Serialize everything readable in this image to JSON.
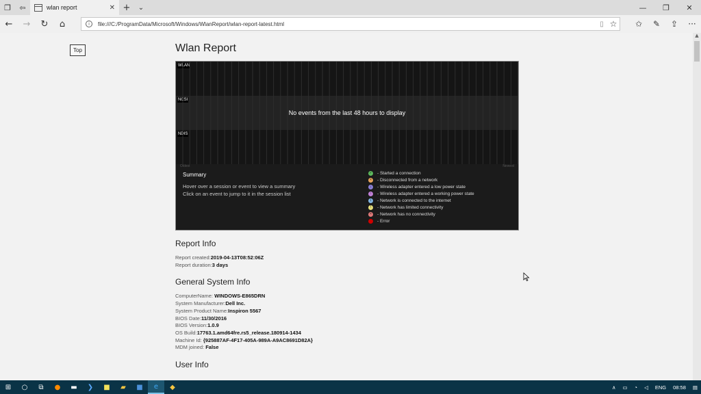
{
  "tab": {
    "title": "wlan report"
  },
  "address": {
    "url": "file:///C:/ProgramData/Microsoft/Windows/WlanReport/wlan-report-latest.html"
  },
  "page": {
    "top_button": "Top",
    "title": "Wlan Report",
    "graph": {
      "lanes": [
        "WLAN",
        "NCSI",
        "NDIS"
      ],
      "no_events": "No events from the last 48 hours to display",
      "axis_left": "Oldest",
      "axis_right": "Newest",
      "summary_title": "Summary",
      "summary_line1": "Hover over a session or event to view a summary",
      "summary_line2": "Click on an event to jump to it in the session list",
      "legend": [
        {
          "label": "- Started a connection",
          "color": "#5cb85c",
          "glyph": "✓"
        },
        {
          "label": "- Disconnected from a network",
          "color": "#e8a35a",
          "glyph": "×"
        },
        {
          "label": "- Wireless adapter entered a low power state",
          "color": "#8a7fd6",
          "glyph": "↓"
        },
        {
          "label": "- Wireless adapter entered a working power state",
          "color": "#c07fd6",
          "glyph": "↑"
        },
        {
          "label": "- Network is connected to the internet",
          "color": "#7fb3e0",
          "glyph": "i"
        },
        {
          "label": "- Network has limited connectivity",
          "color": "#e8e07a",
          "glyph": "!"
        },
        {
          "label": "- Network has no connectivity",
          "color": "#e07a7a",
          "glyph": "×"
        },
        {
          "label": "- Error",
          "color": "#d00000",
          "glyph": ""
        }
      ]
    },
    "report_info": {
      "heading": "Report Info",
      "created_label": "Report created:",
      "created_value": "2019-04-13T08:52:06Z",
      "duration_label": "Report duration:",
      "duration_value": "3 days"
    },
    "system_info": {
      "heading": "General System Info",
      "rows": [
        {
          "label": "ComputerName: ",
          "value": "WINDOWS-E865DRN"
        },
        {
          "label": "System Manufacturer:",
          "value": "Dell Inc."
        },
        {
          "label": "System Product Name:",
          "value": "Inspiron 5567"
        },
        {
          "label": "BIOS Date:",
          "value": "11/30/2016"
        },
        {
          "label": "BIOS Version:",
          "value": "1.0.9"
        },
        {
          "label": "OS Build:",
          "value": "17763.1.amd64fre.rs5_release.180914-1434"
        },
        {
          "label": "Machine Id: ",
          "value": "{925887AF-4F17-405A-989A-A9AC8691D82A}"
        },
        {
          "label": "MDM joined: ",
          "value": "False"
        }
      ]
    },
    "user_info": {
      "heading": "User Info"
    }
  },
  "tray": {
    "lang": "ENG",
    "time": "08:58"
  }
}
